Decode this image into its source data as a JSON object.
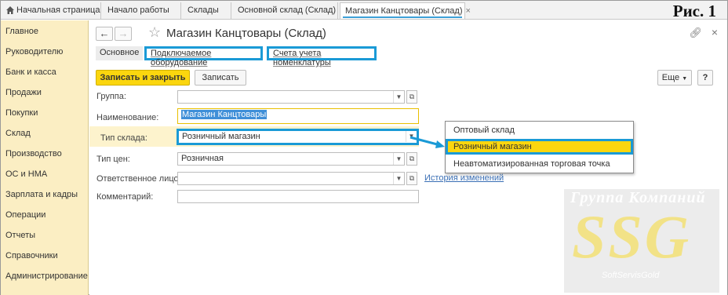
{
  "tabs": {
    "home": "Начальная страница",
    "items": [
      "Начало работы",
      "Склады",
      "Основной склад (Склад)"
    ],
    "active": "Магазин Канцтовары (Склад)",
    "close_glyph": "×"
  },
  "figure_label": "Рис. 1",
  "sidebar": {
    "items": [
      "Главное",
      "Руководителю",
      "Банк и касса",
      "Продажи",
      "Покупки",
      "Склад",
      "Производство",
      "ОС и НМА",
      "Зарплата и кадры",
      "Операции",
      "Отчеты",
      "Справочники",
      "Администрирование"
    ]
  },
  "form": {
    "title": "Магазин Канцтовары (Склад)",
    "subtabs": {
      "basic": "Основное",
      "equipment": "Подключаемое оборудование",
      "accounts": "Счета учета номенклатуры"
    },
    "buttons": {
      "save_close": "Записать и закрыть",
      "save": "Записать",
      "more": "Еще",
      "help": "?"
    },
    "fields": {
      "group_label": "Группа:",
      "group_value": "",
      "name_label": "Наименование:",
      "name_value": "Магазин Канцтовары",
      "type_label": "Тип склада:",
      "type_value": "Розничный магазин",
      "price_label": "Тип цен:",
      "price_value": "Розничная",
      "responsible_label": "Ответственное лицо:",
      "responsible_value": "",
      "comment_label": "Комментарий:",
      "comment_value": ""
    },
    "history_link": "История изменений"
  },
  "dropdown": {
    "options": [
      "Оптовый склад",
      "Розничный магазин",
      "Неавтоматизированная торговая точка"
    ],
    "selected_index": 1
  },
  "watermark": {
    "top": "Группа Компаний",
    "big": "SSG",
    "small": "SoftServisGold"
  },
  "colors": {
    "accent_blue": "#1a9ad6",
    "primary_yellow": "#fbd60e",
    "sidebar_bg": "#fbeec3"
  }
}
